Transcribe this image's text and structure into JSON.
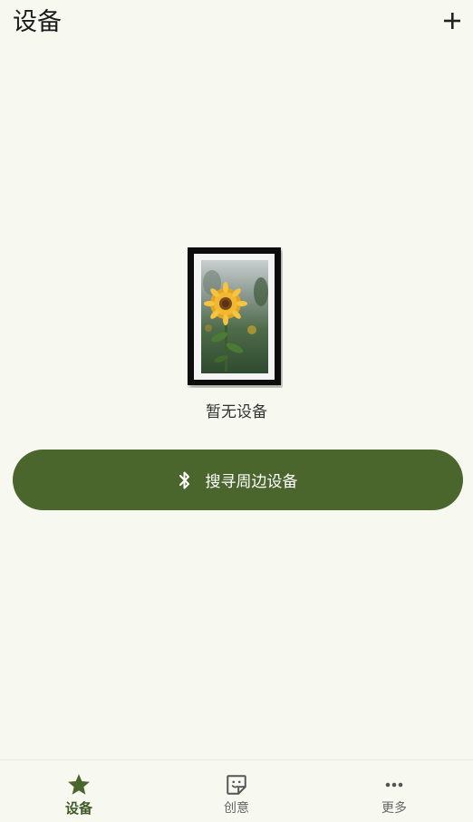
{
  "header": {
    "title": "设备",
    "add_icon": "plus-icon"
  },
  "main": {
    "illustration": "sunflower-photo-frame",
    "empty_text": "暂无设备",
    "scan_button_label": "搜寻周边设备",
    "scan_button_icon": "bluetooth-icon"
  },
  "bottom_nav": {
    "items": [
      {
        "label": "设备",
        "icon": "star-icon",
        "active": true
      },
      {
        "label": "创意",
        "icon": "sticker-icon",
        "active": false
      },
      {
        "label": "更多",
        "icon": "more-dots-icon",
        "active": false
      }
    ]
  },
  "colors": {
    "background": "#f7f8f0",
    "accent": "#4b662d",
    "nav_active": "#3f5a26",
    "nav_inactive": "#666666"
  }
}
